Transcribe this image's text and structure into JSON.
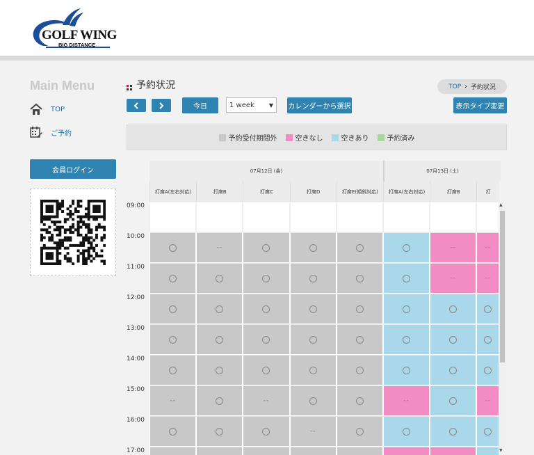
{
  "logo": {
    "main": "GOLF WING",
    "sub": "BIG DISTANCE",
    "brand_color": "#1b4d9b"
  },
  "sidebar": {
    "title": "Main Menu",
    "items": [
      {
        "label": "TOP",
        "icon": "home-icon"
      },
      {
        "label": "ご予約",
        "icon": "calendar-edit-icon"
      }
    ],
    "login_label": "会員ログイン"
  },
  "page": {
    "title": "予約状況"
  },
  "breadcrumb": {
    "top": "TOP",
    "separator": "›",
    "current": "予約状況"
  },
  "toolbar": {
    "prev_icon": "chevron-left-icon",
    "next_icon": "chevron-right-icon",
    "today_label": "今日",
    "range_value": "1 week",
    "calendar_label": "カレンダーから選択",
    "view_type_label": "表示タイプ変更"
  },
  "legend": [
    {
      "label": "予約受付期間外",
      "color": "#c8c8c8"
    },
    {
      "label": "空きなし",
      "color": "#f28dc4"
    },
    {
      "label": "空きあり",
      "color": "#a8d8ea"
    },
    {
      "label": "予約済み",
      "color": "#a5d99a"
    }
  ],
  "schedule": {
    "days": [
      {
        "date": "07月12日 (金)",
        "lanes": [
          "打席A(左右対応)",
          "打席B",
          "打席C",
          "打席D",
          "打席E(傾斜対応)"
        ]
      },
      {
        "date": "07月13日 (土)",
        "lanes": [
          "打席A(左右対応)",
          "打席B",
          "打"
        ]
      }
    ],
    "times": [
      "09:00",
      "10:00",
      "11:00",
      "12:00",
      "13:00",
      "14:00",
      "15:00",
      "16:00",
      "17:00"
    ],
    "status_colors": {
      "outside": "#c8c8c8",
      "full": "#f28dc4",
      "open": "#a8d8ea",
      "none": "#ffffff"
    },
    "rows": [
      [
        "none",
        "none",
        "none",
        "none",
        "none",
        "none",
        "none",
        "none"
      ],
      [
        "outside:o",
        "outside:-",
        "outside:o",
        "outside:o",
        "outside:o",
        "open:o",
        "full:-",
        "full:-"
      ],
      [
        "outside:o",
        "outside:o",
        "outside:o",
        "outside:o",
        "outside:o",
        "open:o",
        "full:-",
        "full:-"
      ],
      [
        "outside:o",
        "outside:o",
        "outside:o",
        "outside:o",
        "outside:o",
        "open:o",
        "open:o",
        "open:o"
      ],
      [
        "outside:o",
        "outside:o",
        "outside:o",
        "outside:o",
        "outside:o",
        "open:o",
        "open:o",
        "open:o"
      ],
      [
        "outside:o",
        "outside:o",
        "outside:o",
        "outside:o",
        "outside:o",
        "open:o",
        "open:o",
        "open:o"
      ],
      [
        "outside:-",
        "outside:o",
        "outside:-",
        "outside:o",
        "outside:o",
        "full:-",
        "open:o",
        "full:-"
      ],
      [
        "outside:o",
        "outside:o",
        "outside:o",
        "outside:-",
        "outside:o",
        "open:o",
        "open:o",
        "open:o"
      ],
      [
        "outside:o",
        "outside:o",
        "outside:o",
        "outside:o",
        "outside:o",
        "full:-",
        "full:-",
        "open:o"
      ]
    ],
    "dash_text": "--"
  }
}
